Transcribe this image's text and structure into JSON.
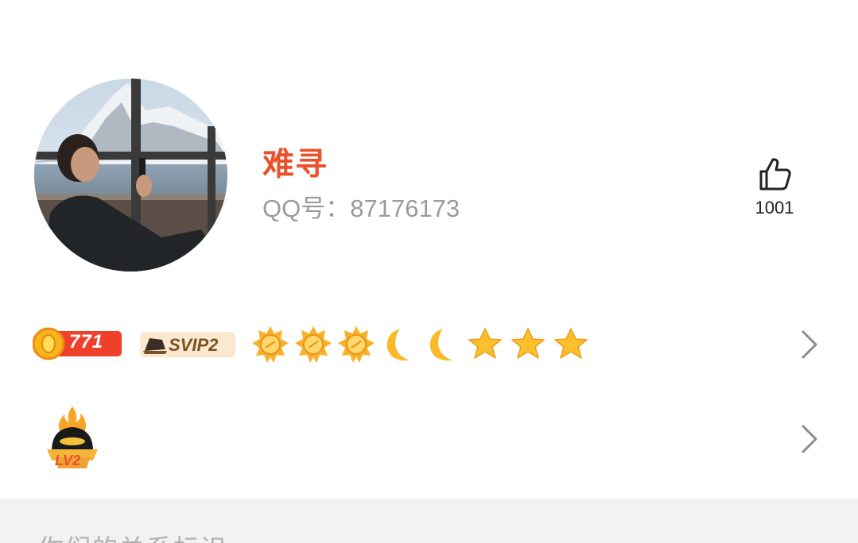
{
  "profile": {
    "name": "难寻",
    "qq_label": "QQ号：",
    "qq_number": "87176173"
  },
  "likes": {
    "count": "1001",
    "icon": "thumbs-up-icon"
  },
  "badges": {
    "coin_count": "771",
    "svip_label": "SVIP2",
    "qq_level_icons": [
      "sun-icon",
      "sun-icon",
      "sun-icon",
      "moon-icon",
      "moon-icon",
      "star-icon",
      "star-icon",
      "star-icon"
    ],
    "lv_badge_label": "LV2"
  },
  "section": {
    "title": "你们的关系标识"
  },
  "colors": {
    "name": "#e8532e",
    "secondary_text": "#9b9b9b",
    "section_bg": "#f2f2f5"
  }
}
